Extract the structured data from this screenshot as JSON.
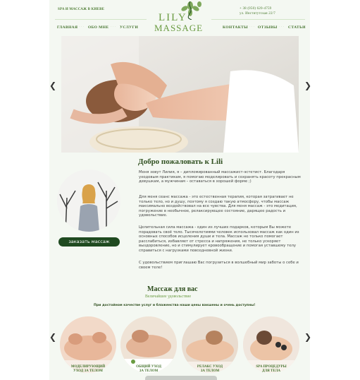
{
  "header": {
    "tagline": "SPA И МАССАЖ В КИЕВЕ",
    "phone": "+ 38 (050) 620-4759",
    "address": "ул. Институтская 22/7",
    "logo_top": "LILY",
    "logo_bottom": "MASSAGE"
  },
  "nav": {
    "items": [
      "ГЛАВНАЯ",
      "ОБО МНЕ",
      "УСЛУГИ",
      "КОНТАКТЫ",
      "ОТЗЫВЫ",
      "СТАТЬИ"
    ]
  },
  "hero": {
    "prev_icon": "chevron-left-icon",
    "next_icon": "chevron-right-icon"
  },
  "welcome": {
    "title": "Добро пожаловать к Lili",
    "paragraphs": [
      "Меня зовут Лилия, я – дипломированный массажист-эстетист. Благодаря уходовым практикам, я помогаю моделировать и сохранять красоту прекрасным девушкам, а мужчинам – оставаться в хорошей форме ;)",
      "Для меня сеанс массажа - это естественная терапия, которая затрагивает не только тело, но и душу, поэтому я создаю такую атмосферу, чтобы массаж максимально воздействовал на все чувства. Для меня массаж - это медитация, погружение в необычное, релаксирующее состояние, дарящее радость и удовольствие.",
      "Целительная сила массажа - один из лучших подарков, которым Вы можете порадовать своё тело. Тысячелетиями человек использовал массаж как один из основных способов исцеления души и тела. Массаж не только помогает расслабиться, избавляет от стресса и напряжения, не только ускоряет выздоровление, но и стимулирует кровообращение и помогая уставшему телу справиться с нагрузками повседневной жизни.",
      "С удовольствием приглашаю Вас погрузиться в волшебный мир заботы о себе и своем теле!"
    ],
    "order_button": "заказать массаж"
  },
  "services": {
    "title": "Массаж для вас",
    "subtitle": "Величайшее удовольствие",
    "note": "При достойном качестве услуг и блаженства наши цены вакшены и очень доступны!",
    "items": [
      {
        "line1": "МОДЕЛИРУЮЩИЙ",
        "line2": "УХОД ЗА ТЕЛОМ"
      },
      {
        "line1": "ОБЩИЙ УХОД",
        "line2": "ЗА ТЕЛОМ"
      },
      {
        "line1": "РЕЛАКС УХОД",
        "line2": "ЗА ТЕЛОМ"
      },
      {
        "line1": "SPA ПРОЦЕДУРЫ",
        "line2": "ДЛЯ ТЕЛА"
      }
    ]
  },
  "colors": {
    "brand_green": "#6a9b42",
    "dark_green": "#1f4a20",
    "text_green": "#3f6f27"
  }
}
